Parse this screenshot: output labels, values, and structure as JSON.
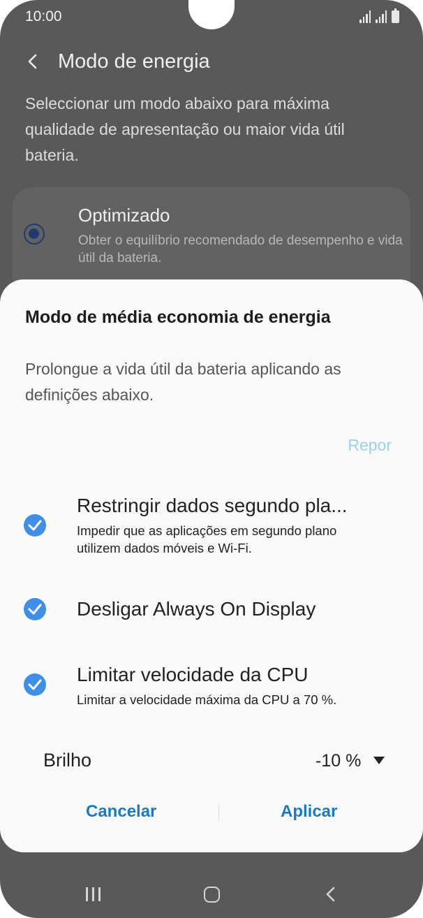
{
  "status_bar": {
    "time": "10:00"
  },
  "header": {
    "title": "Modo de energia"
  },
  "page": {
    "description": "Seleccionar um modo abaixo para máxima qualidade de apresentação ou maior vida útil bateria."
  },
  "option": {
    "title": "Optimizado",
    "description": "Obter o equilíbrio recomendado de desempenho e vida útil da bateria.",
    "selected": true
  },
  "dialog": {
    "title": "Modo de média economia de energia",
    "description": "Prolongue a vida útil da bateria aplicando as definições abaixo.",
    "reset_label": "Repor",
    "items": [
      {
        "title": "Restringir dados segundo pla...",
        "description": "Impedir que as aplicações em segundo plano utilizem dados móveis e Wi-Fi.",
        "checked": true
      },
      {
        "title": "Desligar Always On Display",
        "description": "",
        "checked": true
      },
      {
        "title": "Limitar velocidade da CPU",
        "description": "Limitar a velocidade máxima da CPU a 70 %.",
        "checked": true
      }
    ],
    "brightness": {
      "label": "Brilho",
      "value": "-10 %"
    },
    "cancel_label": "Cancelar",
    "apply_label": "Aplicar"
  },
  "colors": {
    "accent": "#1b7bc0",
    "check": "#3f8fe6",
    "reset": "#9fd0ea",
    "dim_overlay": "#595959"
  },
  "icons": {
    "back": "arrow-left-icon",
    "check": "check-circle-icon",
    "dropdown": "triangle-down-icon",
    "nav_recent": "recent-apps-icon",
    "nav_home": "home-icon",
    "nav_back": "back-icon"
  }
}
